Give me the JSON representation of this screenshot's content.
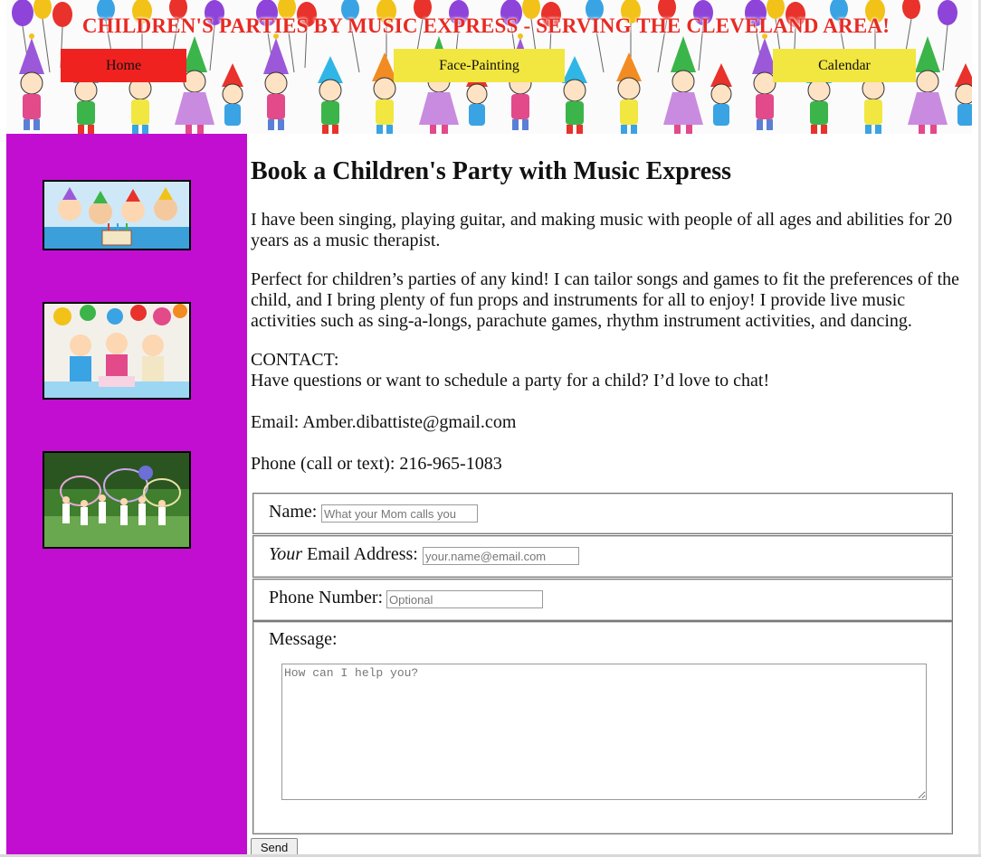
{
  "header": {
    "title": "CHILDREN'S PARTIES BY MUSIC EXPRESS - SERVING THE CLEVELAND AREA!",
    "nav": [
      {
        "label": "Home",
        "active": true
      },
      {
        "label": "Face-Painting",
        "active": false
      },
      {
        "label": "Calendar",
        "active": false
      }
    ]
  },
  "sidebar": {
    "background": "#c20ed1",
    "photos": [
      "kids-party-cake-photo",
      "girls-birthday-party-photo",
      "kids-hula-hoop-party-photo"
    ]
  },
  "main": {
    "heading": "Book a Children's Party with Music Express",
    "intro": "I have been singing, playing guitar, and making music with people of all ages and abilities for 20 years as a music therapist.",
    "perfect": "Perfect for children’s parties of any kind! I can tailor songs and games to fit the preferences of the child, and I bring plenty of fun props and instruments for all to enjoy! I provide live music activities such as sing-a-longs, parachute games, rhythm instrument activities, and dancing.",
    "contact_label": "CONTACT:",
    "contact_text": "Have questions or want to schedule a party for a child? I’d love to chat!",
    "email": "Email: Amber.dibattiste@gmail.com",
    "phone": "Phone (call or text): 216-965-1083"
  },
  "form": {
    "name_label": "Name:",
    "name_placeholder": "What your Mom calls you",
    "email_label_em": "Your",
    "email_label_rest": " Email Address:",
    "email_placeholder": "your.name@email.com",
    "phone_label": "Phone Number:",
    "phone_placeholder": "Optional",
    "message_label": "Message:",
    "message_placeholder": "How can I help you?",
    "send_label": "Send"
  },
  "colors": {
    "title_red": "#e82a24",
    "home_button": "#f0221f",
    "nav_yellow": "#f2e640",
    "sidebar_purple": "#c20ed1"
  }
}
